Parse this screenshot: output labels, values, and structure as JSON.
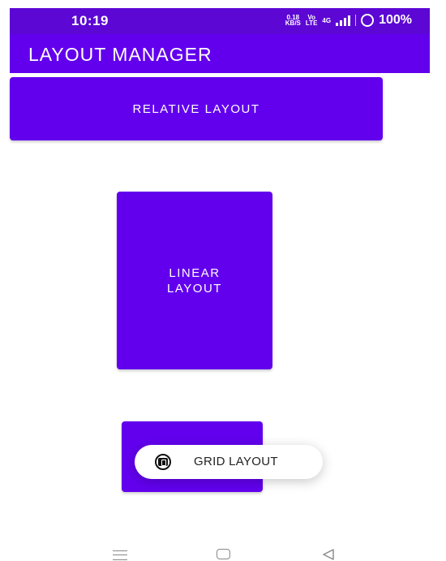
{
  "status_bar": {
    "time": "10:19",
    "net_speed_top": "0.18",
    "net_speed_bottom": "KB/S",
    "volte_top": "Vo",
    "volte_bottom": "LTE",
    "network_type": "4G",
    "battery": "100%"
  },
  "app_bar": {
    "title": "LAYOUT MANAGER"
  },
  "buttons": {
    "relative": "RELATIVE LAYOUT",
    "linear": "LINEAR\nLAYOUT",
    "grid": "GRID LAYOUT"
  },
  "toast": {
    "message": "GRID LAYOUT"
  },
  "colors": {
    "accent": "#6200ee",
    "status_bar": "#5c07d4",
    "nav_icon": "#888888"
  },
  "icons": {
    "toast": "app-icon",
    "nav_menu": "menu-lines-icon",
    "nav_home": "home-square-icon",
    "nav_back": "back-triangle-icon"
  }
}
